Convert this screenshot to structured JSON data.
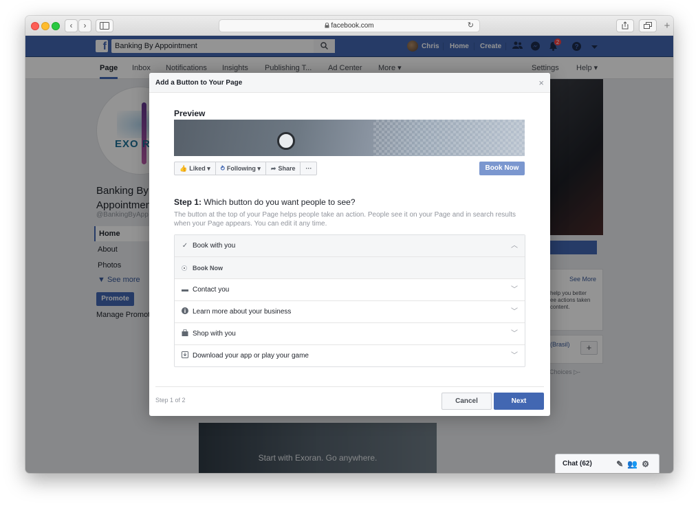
{
  "browser": {
    "url": "facebook.com",
    "lock_icon": "lock-icon",
    "back": "‹",
    "forward": "›"
  },
  "fb_header": {
    "search_value": "Banking By Appointment",
    "user_name": "Chris",
    "home": "Home",
    "create": "Create",
    "notification_count": "2"
  },
  "page_tabs": [
    "Page",
    "Inbox",
    "Notifications",
    "Insights",
    "Publishing T...",
    "Ad Center",
    "More ▾",
    "Settings",
    "Help ▾"
  ],
  "page": {
    "logo_text": "EXO R",
    "name_line1": "Banking By",
    "name_line2": "Appointment",
    "handle": "@BankingByApp",
    "nav": [
      "Home",
      "About",
      "Photos",
      "▼ See more"
    ],
    "promote": "Promote",
    "manage": "Manage Promoti",
    "right_see_more": "See More",
    "right_card_text": "help you better\nee actions taken\ncontent.",
    "right_lang": "(Brasil)",
    "plus": "+",
    "ad_choices": "Choices ▷-",
    "post_caption": "Start with Exoran. Go anywhere.",
    "chat_label": "Chat (62)"
  },
  "modal": {
    "title": "Add a Button to Your Page",
    "close": "×",
    "preview_label": "Preview",
    "actions": [
      {
        "icon": "👍",
        "label": "Liked ▾"
      },
      {
        "icon": "⥁",
        "label": "Following ▾"
      },
      {
        "icon": "➦",
        "label": "Share"
      },
      {
        "icon": "",
        "label": "···"
      }
    ],
    "book_now_preview": "Book Now",
    "step_prefix": "Step 1:",
    "step_question": "Which button do you want people to see?",
    "description": "The button at the top of your Page helps people take an action. People see it on your Page and in search results when your Page appears. You can edit it any time.",
    "options": [
      {
        "label": "Book with you",
        "expanded": true
      },
      {
        "label": "Book Now",
        "sub": true
      },
      {
        "label": "Contact you"
      },
      {
        "label": "Learn more about your business"
      },
      {
        "label": "Shop with you"
      },
      {
        "label": "Download your app or play your game"
      }
    ],
    "step_counter": "Step 1 of 2",
    "cancel": "Cancel",
    "next": "Next"
  },
  "colors": {
    "fb_blue": "#4267b2",
    "overlay": "#000000"
  }
}
